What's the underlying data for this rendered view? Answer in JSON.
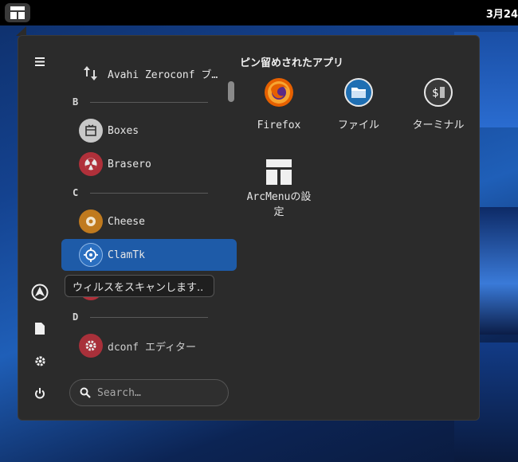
{
  "topbar": {
    "clock": "3月24"
  },
  "sidebar": {
    "icons": [
      "hamburger-icon",
      "arch-icon",
      "document-icon",
      "gear-icon",
      "power-icon"
    ]
  },
  "app_list": {
    "items": [
      {
        "label": "Avahi Zeroconf ブ…",
        "icon": "arrows-icon"
      },
      {
        "label": "Boxes",
        "icon": "boxes-icon"
      },
      {
        "label": "Brasero",
        "icon": "brasero-icon"
      },
      {
        "label": "Cheese",
        "icon": "cheese-icon"
      },
      {
        "label": "ClamTk",
        "icon": "clamtk-icon"
      },
      {
        "label": "dconf エディター",
        "icon": "dconf-icon"
      }
    ],
    "sections": [
      "B",
      "C",
      "D"
    ],
    "tooltip": "ウィルスをスキャンします.."
  },
  "search": {
    "placeholder": "Search…"
  },
  "pinned": {
    "title": "ピン留めされたアプリ",
    "items": [
      {
        "label": "Firefox",
        "icon": "firefox-icon"
      },
      {
        "label": "ファイル",
        "icon": "files-icon"
      },
      {
        "label": "ターミナル",
        "icon": "terminal-icon"
      },
      {
        "label": "ArcMenuの設定",
        "icon": "arcmenu-icon"
      }
    ]
  },
  "colors": {
    "selected": "#1e5ba8",
    "panel": "#2b2b2b",
    "topbar": "#000000"
  }
}
